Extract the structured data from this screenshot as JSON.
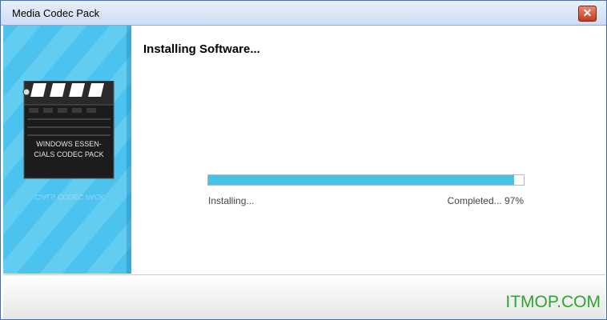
{
  "window": {
    "title": "Media Codec Pack",
    "close_icon": "close-icon"
  },
  "sidebar": {
    "logo": {
      "line1": "WINDOWS ESSEN-",
      "line2": "CIALS CODEC PACK",
      "reflection": "CIALS CODEC PACK"
    }
  },
  "main": {
    "heading": "Installing Software...",
    "progress": {
      "percent": 97
    },
    "status_left": "Installing...",
    "status_right": "Completed... 97%"
  },
  "footer": {
    "watermark": "ITMOP.COM"
  },
  "colors": {
    "accent": "#46c2e6",
    "sidebar": "#4cc2ee",
    "watermark": "#2ea52e"
  }
}
